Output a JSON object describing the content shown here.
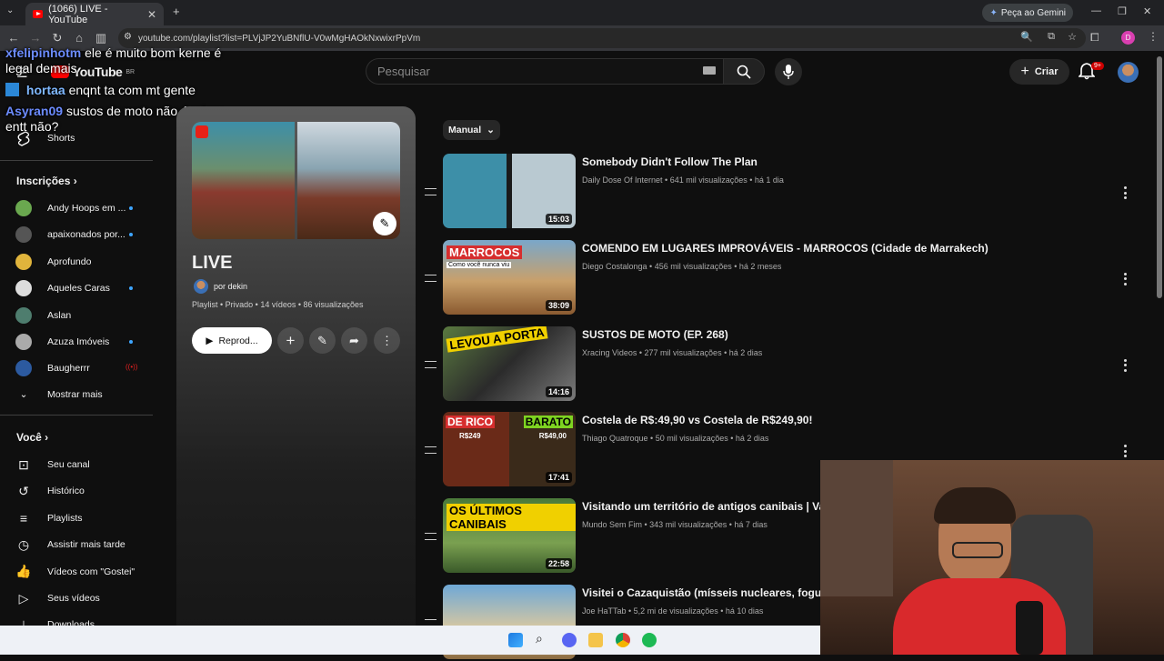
{
  "browser": {
    "tab_title": "(1066) LIVE - YouTube",
    "url": "youtube.com/playlist?list=PLVjJP2YuBNflU-V0wMgHAOkNxwixrPpVm",
    "gemini_label": "Peça ao Gemini",
    "profile_initial": "D"
  },
  "header": {
    "logo_text": "YouTube",
    "region": "BR",
    "search_placeholder": "Pesquisar",
    "create_label": "Criar",
    "notif_count": "9+"
  },
  "chat": [
    {
      "user": "xfelipinhotm",
      "text": "ele é muito bom kerne é legal demais",
      "color": "#6c8cff"
    },
    {
      "user": "hortaa",
      "text": "enqnt ta com mt gente",
      "color": "#7fb8ff"
    },
    {
      "user": "Asyran09",
      "text": "sustos de moto não é a boa entt não?",
      "color": "#6c8cff"
    }
  ],
  "sidebar": {
    "shorts_label": "Shorts",
    "subs_heading": "Inscrições",
    "channels": [
      {
        "name": "Andy Hoops em ...",
        "dot": true,
        "live": false,
        "color": "#6aa84f"
      },
      {
        "name": "apaixonados por...",
        "dot": true,
        "live": false,
        "color": "#555"
      },
      {
        "name": "Aprofundo",
        "dot": false,
        "live": false,
        "color": "#e0b43c"
      },
      {
        "name": "Aqueles Caras",
        "dot": true,
        "live": false,
        "color": "#ddd"
      },
      {
        "name": "Aslan",
        "dot": false,
        "live": false,
        "color": "#4e7d6e"
      },
      {
        "name": "Azuza Imóveis",
        "dot": true,
        "live": false,
        "color": "#aaa"
      },
      {
        "name": "Baugherrr",
        "dot": false,
        "live": true,
        "color": "#2c5aa0"
      }
    ],
    "show_more": "Mostrar mais",
    "you_heading": "Você",
    "you_items": [
      {
        "label": "Seu canal",
        "icon": "account-icon"
      },
      {
        "label": "Histórico",
        "icon": "history-icon"
      },
      {
        "label": "Playlists",
        "icon": "playlists-icon"
      },
      {
        "label": "Assistir mais tarde",
        "icon": "watch-later-icon"
      },
      {
        "label": "Vídeos com \"Gostei\"",
        "icon": "like-icon"
      },
      {
        "label": "Seus vídeos",
        "icon": "your-videos-icon"
      },
      {
        "label": "Downloads",
        "icon": "download-icon"
      }
    ]
  },
  "playlist": {
    "title": "LIVE",
    "owner": "por dekin",
    "meta": "Playlist • Privado • 14 vídeos • 86 visualizações",
    "play_label": "Reprod..."
  },
  "sort_label": "Manual",
  "videos": [
    {
      "title": "Somebody Didn't Follow The Plan",
      "meta": "Daily Dose Of Internet • 641 mil visualizações • há 1 dia",
      "duration": "15:03"
    },
    {
      "title": "COMENDO EM LUGARES IMPROVÁVEIS - MARROCOS (Cidade de Marrakech)",
      "meta": "Diego Costalonga • 456 mil visualizações • há 2 meses",
      "duration": "38:09",
      "thumb_text": "MARROCOS",
      "thumb_sub": "Como você nunca viu"
    },
    {
      "title": "SUSTOS DE MOTO (EP. 268)",
      "meta": "Xracing Videos • 277 mil visualizações • há 2 dias",
      "duration": "14:16",
      "thumb_text": "LEVOU A PORTA"
    },
    {
      "title": "Costela de R$:49,90 vs Costela de R$249,90!",
      "meta": "Thiago Quatroque • 50 mil visualizações • há 2 dias",
      "duration": "17:41",
      "thumb_left": "DE RICO",
      "thumb_right": "BARATO",
      "price_left": "R$249",
      "price_right": "R$49,00"
    },
    {
      "title": "Visitando um território de antigos canibais | Vanua",
      "meta": "Mundo Sem Fim • 343 mil visualizações • há 7 dias",
      "duration": "22:58",
      "thumb_text": "OS ÚLTIMOS CANIBAIS"
    },
    {
      "title": "Visitei o Cazaquistão (mísseis nucleares, foguetes",
      "meta": "Joe HaTTab • 5,2 mi de visualizações • há 10 dias",
      "duration": ""
    }
  ]
}
